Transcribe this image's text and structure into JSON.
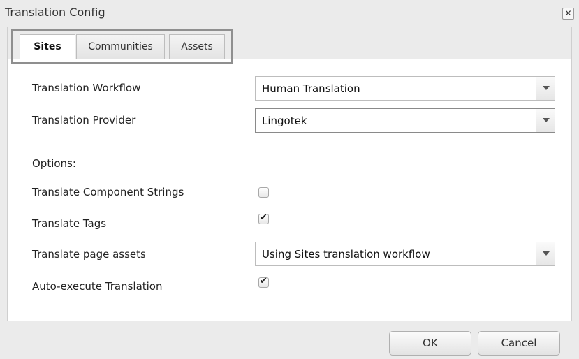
{
  "dialog": {
    "title": "Translation Config",
    "close_glyph": "✕"
  },
  "tabs": [
    {
      "label": "Sites",
      "active": true
    },
    {
      "label": "Communities",
      "active": false
    },
    {
      "label": "Assets",
      "active": false
    }
  ],
  "form": {
    "workflow": {
      "label": "Translation Workflow",
      "value": "Human Translation"
    },
    "provider": {
      "label": "Translation Provider",
      "value": "Lingotek"
    },
    "options_heading": "Options:",
    "component_strings": {
      "label": "Translate Component Strings",
      "checked": false
    },
    "tags": {
      "label": "Translate Tags",
      "checked": true
    },
    "page_assets": {
      "label": "Translate page assets",
      "value": "Using Sites translation workflow"
    },
    "auto_execute": {
      "label": "Auto-execute Translation",
      "checked": true
    },
    "check_glyph": "✔"
  },
  "buttons": {
    "ok": "OK",
    "cancel": "Cancel"
  }
}
